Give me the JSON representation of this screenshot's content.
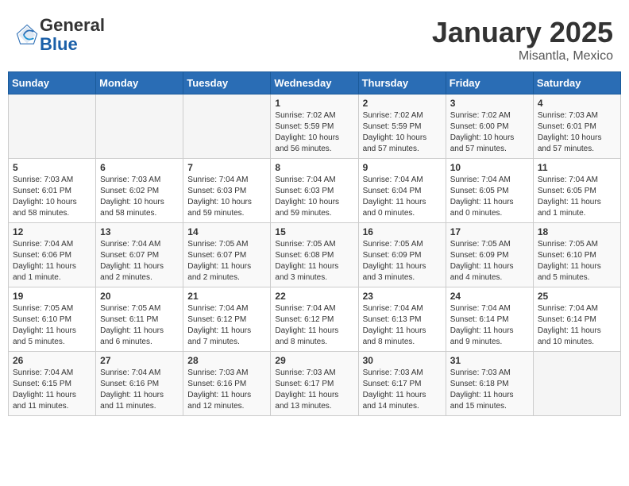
{
  "header": {
    "logo_line1": "General",
    "logo_line2": "Blue",
    "title": "January 2025",
    "subtitle": "Misantla, Mexico"
  },
  "weekdays": [
    "Sunday",
    "Monday",
    "Tuesday",
    "Wednesday",
    "Thursday",
    "Friday",
    "Saturday"
  ],
  "weeks": [
    [
      {
        "day": "",
        "info": ""
      },
      {
        "day": "",
        "info": ""
      },
      {
        "day": "",
        "info": ""
      },
      {
        "day": "1",
        "info": "Sunrise: 7:02 AM\nSunset: 5:59 PM\nDaylight: 10 hours and 56 minutes."
      },
      {
        "day": "2",
        "info": "Sunrise: 7:02 AM\nSunset: 5:59 PM\nDaylight: 10 hours and 57 minutes."
      },
      {
        "day": "3",
        "info": "Sunrise: 7:02 AM\nSunset: 6:00 PM\nDaylight: 10 hours and 57 minutes."
      },
      {
        "day": "4",
        "info": "Sunrise: 7:03 AM\nSunset: 6:01 PM\nDaylight: 10 hours and 57 minutes."
      }
    ],
    [
      {
        "day": "5",
        "info": "Sunrise: 7:03 AM\nSunset: 6:01 PM\nDaylight: 10 hours and 58 minutes."
      },
      {
        "day": "6",
        "info": "Sunrise: 7:03 AM\nSunset: 6:02 PM\nDaylight: 10 hours and 58 minutes."
      },
      {
        "day": "7",
        "info": "Sunrise: 7:04 AM\nSunset: 6:03 PM\nDaylight: 10 hours and 59 minutes."
      },
      {
        "day": "8",
        "info": "Sunrise: 7:04 AM\nSunset: 6:03 PM\nDaylight: 10 hours and 59 minutes."
      },
      {
        "day": "9",
        "info": "Sunrise: 7:04 AM\nSunset: 6:04 PM\nDaylight: 11 hours and 0 minutes."
      },
      {
        "day": "10",
        "info": "Sunrise: 7:04 AM\nSunset: 6:05 PM\nDaylight: 11 hours and 0 minutes."
      },
      {
        "day": "11",
        "info": "Sunrise: 7:04 AM\nSunset: 6:05 PM\nDaylight: 11 hours and 1 minute."
      }
    ],
    [
      {
        "day": "12",
        "info": "Sunrise: 7:04 AM\nSunset: 6:06 PM\nDaylight: 11 hours and 1 minute."
      },
      {
        "day": "13",
        "info": "Sunrise: 7:04 AM\nSunset: 6:07 PM\nDaylight: 11 hours and 2 minutes."
      },
      {
        "day": "14",
        "info": "Sunrise: 7:05 AM\nSunset: 6:07 PM\nDaylight: 11 hours and 2 minutes."
      },
      {
        "day": "15",
        "info": "Sunrise: 7:05 AM\nSunset: 6:08 PM\nDaylight: 11 hours and 3 minutes."
      },
      {
        "day": "16",
        "info": "Sunrise: 7:05 AM\nSunset: 6:09 PM\nDaylight: 11 hours and 3 minutes."
      },
      {
        "day": "17",
        "info": "Sunrise: 7:05 AM\nSunset: 6:09 PM\nDaylight: 11 hours and 4 minutes."
      },
      {
        "day": "18",
        "info": "Sunrise: 7:05 AM\nSunset: 6:10 PM\nDaylight: 11 hours and 5 minutes."
      }
    ],
    [
      {
        "day": "19",
        "info": "Sunrise: 7:05 AM\nSunset: 6:10 PM\nDaylight: 11 hours and 5 minutes."
      },
      {
        "day": "20",
        "info": "Sunrise: 7:05 AM\nSunset: 6:11 PM\nDaylight: 11 hours and 6 minutes."
      },
      {
        "day": "21",
        "info": "Sunrise: 7:04 AM\nSunset: 6:12 PM\nDaylight: 11 hours and 7 minutes."
      },
      {
        "day": "22",
        "info": "Sunrise: 7:04 AM\nSunset: 6:12 PM\nDaylight: 11 hours and 8 minutes."
      },
      {
        "day": "23",
        "info": "Sunrise: 7:04 AM\nSunset: 6:13 PM\nDaylight: 11 hours and 8 minutes."
      },
      {
        "day": "24",
        "info": "Sunrise: 7:04 AM\nSunset: 6:14 PM\nDaylight: 11 hours and 9 minutes."
      },
      {
        "day": "25",
        "info": "Sunrise: 7:04 AM\nSunset: 6:14 PM\nDaylight: 11 hours and 10 minutes."
      }
    ],
    [
      {
        "day": "26",
        "info": "Sunrise: 7:04 AM\nSunset: 6:15 PM\nDaylight: 11 hours and 11 minutes."
      },
      {
        "day": "27",
        "info": "Sunrise: 7:04 AM\nSunset: 6:16 PM\nDaylight: 11 hours and 11 minutes."
      },
      {
        "day": "28",
        "info": "Sunrise: 7:03 AM\nSunset: 6:16 PM\nDaylight: 11 hours and 12 minutes."
      },
      {
        "day": "29",
        "info": "Sunrise: 7:03 AM\nSunset: 6:17 PM\nDaylight: 11 hours and 13 minutes."
      },
      {
        "day": "30",
        "info": "Sunrise: 7:03 AM\nSunset: 6:17 PM\nDaylight: 11 hours and 14 minutes."
      },
      {
        "day": "31",
        "info": "Sunrise: 7:03 AM\nSunset: 6:18 PM\nDaylight: 11 hours and 15 minutes."
      },
      {
        "day": "",
        "info": ""
      }
    ]
  ]
}
